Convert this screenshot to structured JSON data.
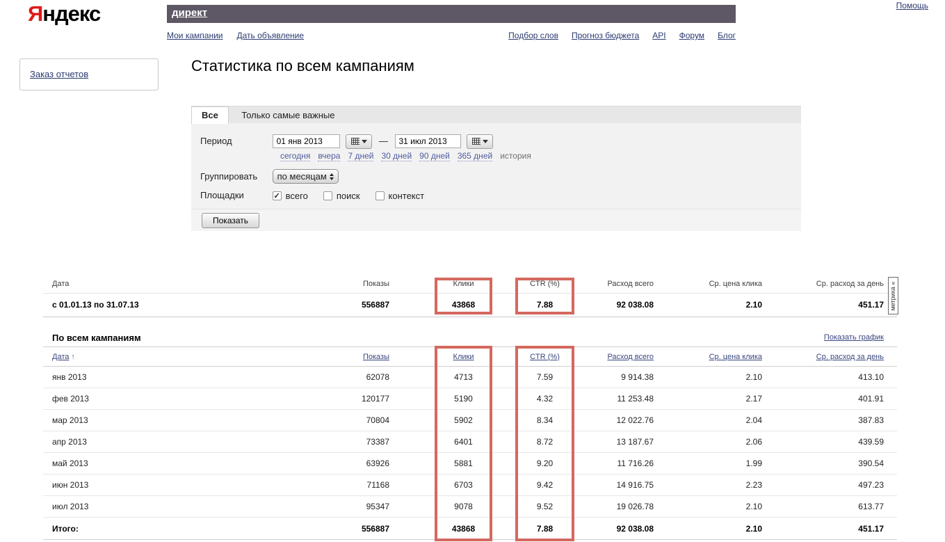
{
  "header": {
    "logo_first_letter": "Я",
    "logo_rest": "ндекс",
    "service_title": "директ",
    "help_link": "Помощь",
    "nav_left": [
      "Мои кампании",
      "Дать объявление"
    ],
    "nav_right": [
      "Подбор слов",
      "Прогноз бюджета",
      "API",
      "Форум",
      "Блог"
    ]
  },
  "sidebar": {
    "order_reports_link": "Заказ отчетов"
  },
  "page": {
    "title": "Статистика по всем кампаниям"
  },
  "filter": {
    "tabs": [
      {
        "label": "Все",
        "active": true
      },
      {
        "label": "Только самые важные",
        "active": false
      }
    ],
    "period": {
      "label": "Период",
      "from_value": "01 янв 2013",
      "to_value": "31 июл 2013",
      "dash": "—",
      "quick_links": [
        "сегодня",
        "вчера",
        "7 дней",
        "30 дней",
        "90 дней",
        "365 дней"
      ],
      "history_label": "история"
    },
    "group": {
      "label": "Группировать",
      "selected": "по месяцам"
    },
    "platforms": {
      "label": "Площадки",
      "options": [
        {
          "label": "всего",
          "checked": true
        },
        {
          "label": "поиск",
          "checked": false
        },
        {
          "label": "контекст",
          "checked": false
        }
      ]
    },
    "submit_label": "Показать"
  },
  "summary_table": {
    "columns": [
      "Дата",
      "Показы",
      "Клики",
      "CTR (%)",
      "Расход всего",
      "Ср. цена клика",
      "Ср. расход за день"
    ],
    "row": {
      "date": "с 01.01.13 по 31.07.13",
      "values": [
        "556887",
        "43868",
        "7.88",
        "92 038.08",
        "2.10",
        "451.17"
      ]
    },
    "metrika_tab": "метрика «"
  },
  "campaigns_table": {
    "title": "По всем кампаниям",
    "show_chart_link": "Показать график",
    "columns": [
      "Дата",
      "Показы",
      "Клики",
      "CTR (%)",
      "Расход всего",
      "Ср. цена клика",
      "Ср. расход за день"
    ],
    "sort_arrow": "↑",
    "rows": [
      {
        "date": "янв 2013",
        "values": [
          "62078",
          "4713",
          "7.59",
          "9 914.38",
          "2.10",
          "413.10"
        ]
      },
      {
        "date": "фев 2013",
        "values": [
          "120177",
          "5190",
          "4.32",
          "11 253.48",
          "2.17",
          "401.91"
        ]
      },
      {
        "date": "мар 2013",
        "values": [
          "70804",
          "5902",
          "8.34",
          "12 022.76",
          "2.04",
          "387.83"
        ]
      },
      {
        "date": "апр 2013",
        "values": [
          "73387",
          "6401",
          "8.72",
          "13 187.67",
          "2.06",
          "439.59"
        ]
      },
      {
        "date": "май 2013",
        "values": [
          "63926",
          "5881",
          "9.20",
          "11 716.26",
          "1.99",
          "390.54"
        ]
      },
      {
        "date": "июн 2013",
        "values": [
          "71168",
          "6703",
          "9.42",
          "14 916.75",
          "2.23",
          "497.23"
        ]
      },
      {
        "date": "июл 2013",
        "values": [
          "95347",
          "9078",
          "9.52",
          "19 026.78",
          "2.10",
          "613.77"
        ]
      }
    ],
    "total": {
      "date": "Итого:",
      "values": [
        "556887",
        "43868",
        "7.88",
        "92 038.08",
        "2.10",
        "451.17"
      ]
    }
  },
  "colors": {
    "banner": "#5e5765",
    "annotation_red": "#d5685e",
    "link_navy": "#2b3a70"
  }
}
